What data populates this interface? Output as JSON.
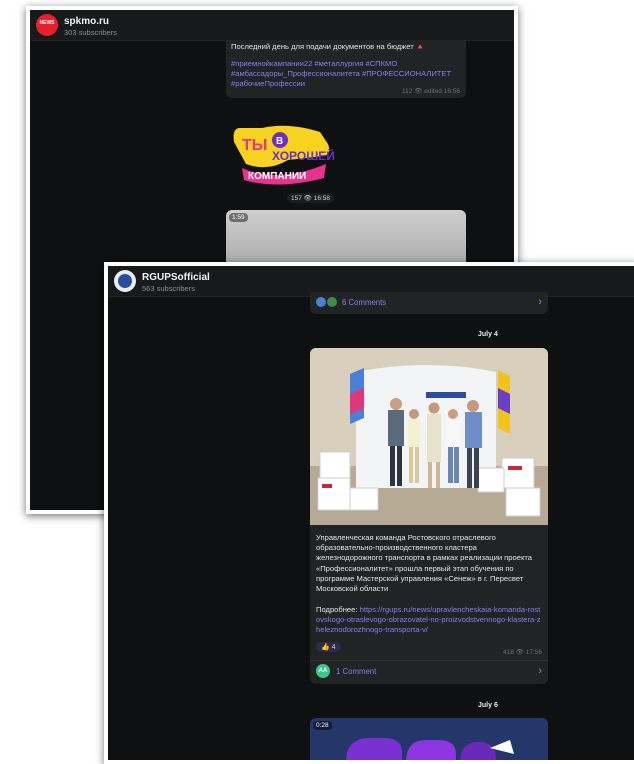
{
  "back_window": {
    "channel_name": "spkmo.ru",
    "subscribers": "303 subscribers",
    "avatar_text": "NEWS",
    "post_line": "Последний день для подачи документов на бюджет",
    "post_emoji": "🔺",
    "hashtags": "#приемнойкампании22 #металлургия #СПКМО #амбассадоры_Профессионалитета #ПРОФЕССИОНАЛИТЕТ #рабочиеПрофессии",
    "post_meta": "112 👁 edited 16:56",
    "sticker_lines": [
      "ТЫ",
      "В",
      "ХОРОШЕЙ",
      "КОМПАНИИ"
    ],
    "sticker_meta": "157 👁 16:58",
    "video_duration": "1:59"
  },
  "front_window": {
    "channel_name": "RGUPSofficial",
    "subscribers": "563 subscribers",
    "top_comments": "6 Comments",
    "date1": "July 4",
    "post_text": "Управленческая команда Ростовского отраслевого образовательно-производственного кластера железнодорожного транспорта в рамках реализации проекта «Профессионалитет» прошла первый этап обучения по программе Мастерской управления «Сенеж» в г. Пересвет Московской области",
    "more_label": "Подробнее: ",
    "more_link": "https://rgups.ru/news/upravlencheskaia-komanda-rostovskogo-otraslevogo-obrazovatel-no-proizvodstvennogo-klastera-zheleznodorozhnogo-transporta-v/",
    "reaction_emoji": "👍",
    "reaction_count": "4",
    "post_meta": "418 👁 17:56",
    "comment_avatar": "AA",
    "comment_label": "1 Comment",
    "date2": "July 6",
    "video_duration": "0:28"
  },
  "colors": {
    "accent": "#8d7cf0",
    "bubble": "#212325",
    "background": "#0e1011",
    "sticker_yellow": "#f7d21e",
    "sticker_pink": "#e8338e",
    "sticker_purple": "#6b2fc7"
  }
}
